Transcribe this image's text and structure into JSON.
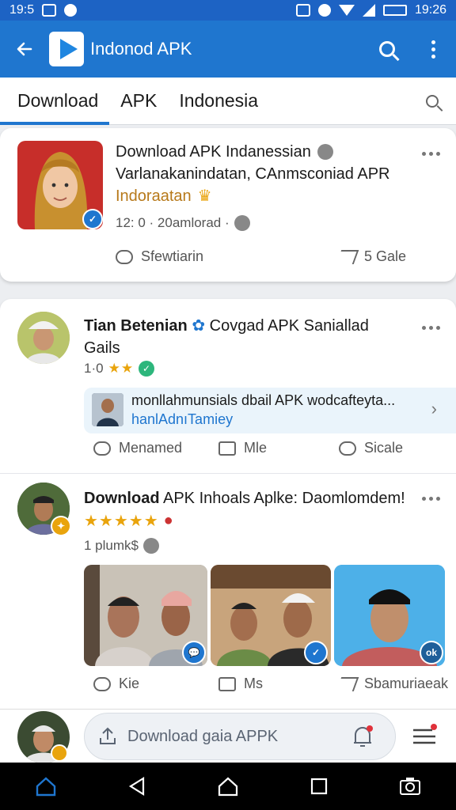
{
  "status": {
    "time_left": "19:5",
    "time_right": "19:26"
  },
  "app": {
    "title": "Indonod APK"
  },
  "tabs": [
    {
      "label": "Download"
    },
    {
      "label": "APK"
    },
    {
      "label": "Indonesia"
    }
  ],
  "post1": {
    "line1": "Download APK Indanessian",
    "line2": "Varlanakanindatan, CAnmsconiad APR",
    "line3": "Indoraatan",
    "meta": "12: 0 · 20amlorad ·",
    "action_left": "Sfewtiarin",
    "action_right": "5 Gale"
  },
  "post2": {
    "author": "Tian Betenian",
    "title_rest": "Covgad APK Saniallad",
    "title_line2": "Gails",
    "rating": "1·0",
    "link_text": "monllahmunsials dbail APK wodcafteyta...",
    "link_sub": "hanlAdnıTamiey",
    "actions": [
      "Menamed",
      "Mle",
      "Sicale"
    ]
  },
  "post3": {
    "title_bold": "Download",
    "title_rest": "APK Inhoals Aplke: Daomlomdem!",
    "meta": "1 plumk$",
    "actions": [
      "Kie",
      "Ms",
      "Sbamuriaeak"
    ]
  },
  "composer": {
    "placeholder": "Download gaia APPK"
  }
}
